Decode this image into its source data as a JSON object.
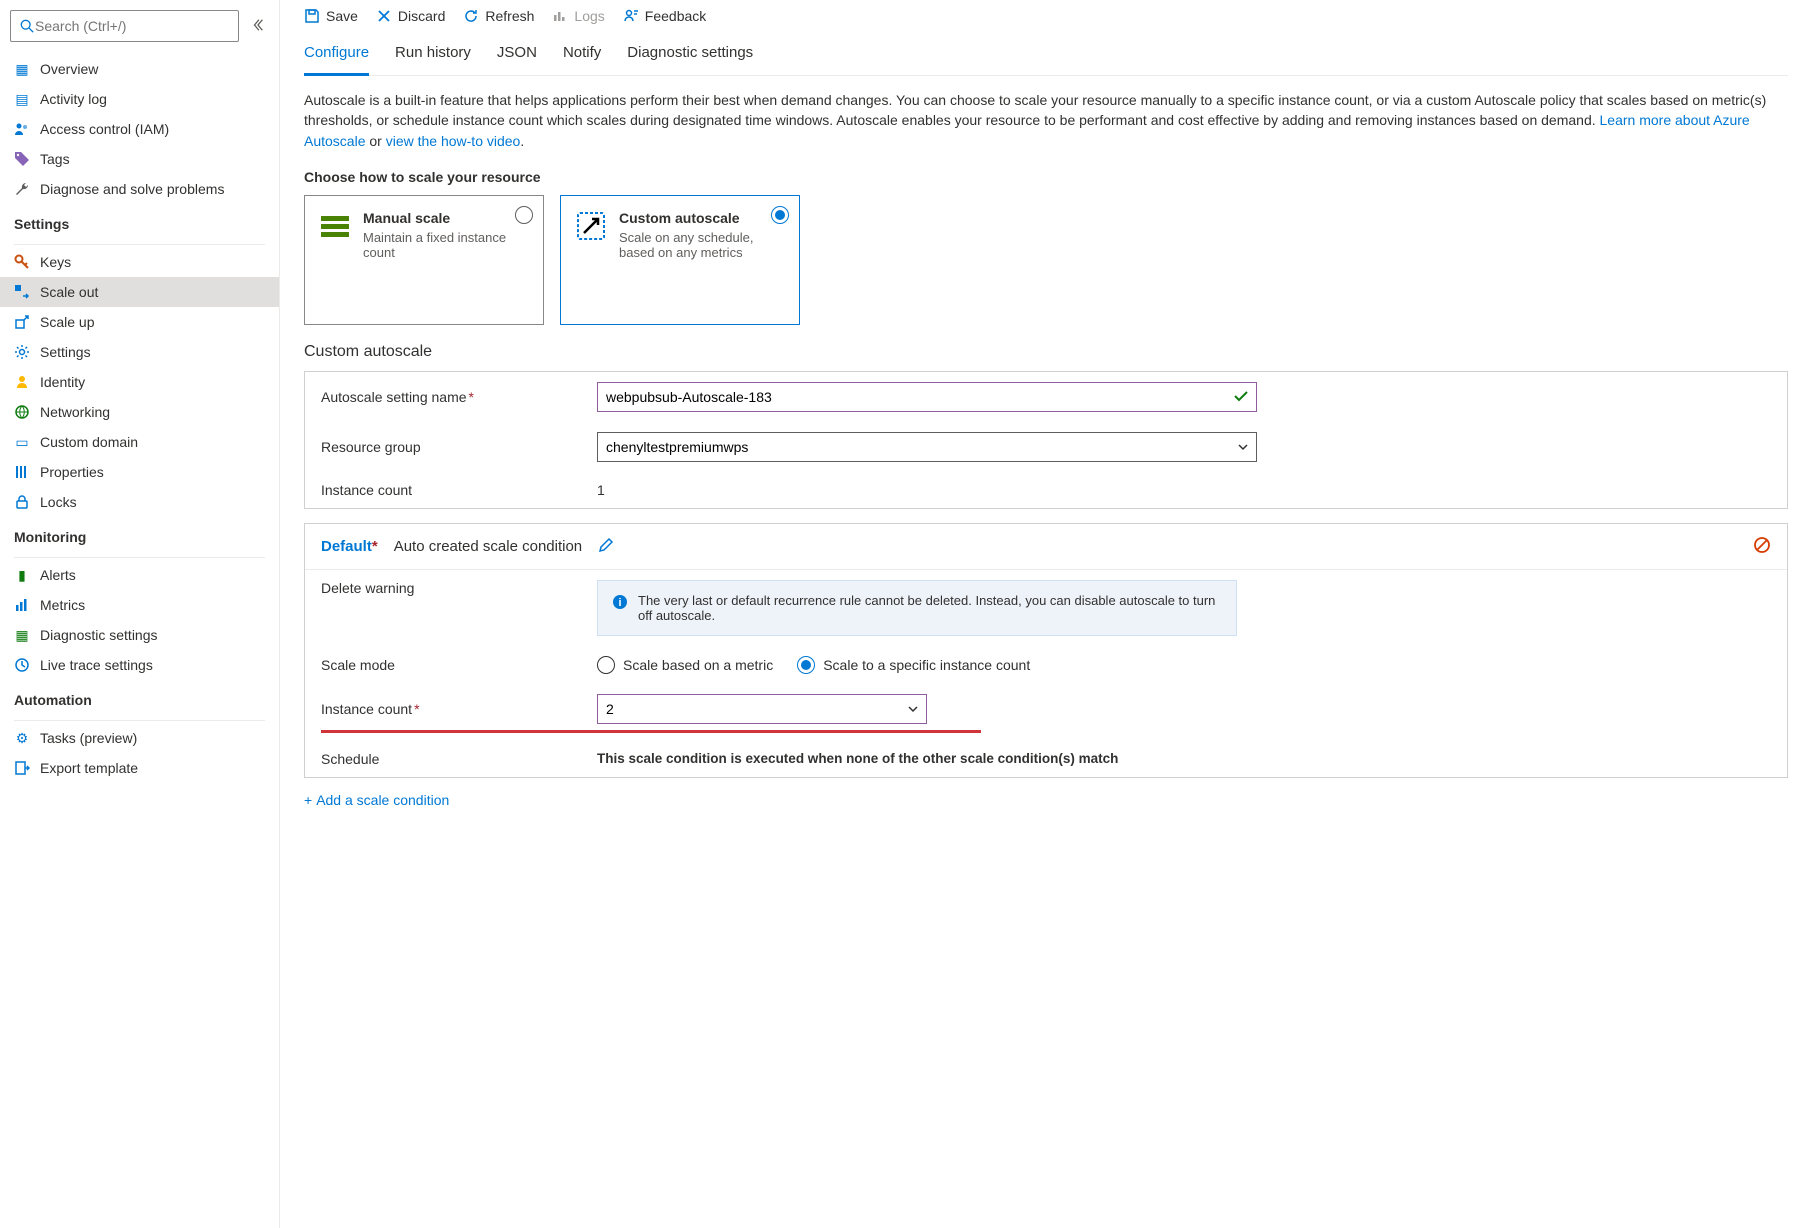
{
  "search": {
    "placeholder": "Search (Ctrl+/)"
  },
  "sidebar": {
    "items": [
      {
        "label": "Overview"
      },
      {
        "label": "Activity log"
      },
      {
        "label": "Access control (IAM)"
      },
      {
        "label": "Tags"
      },
      {
        "label": "Diagnose and solve problems"
      }
    ],
    "settings_title": "Settings",
    "settings": [
      {
        "label": "Keys"
      },
      {
        "label": "Scale out"
      },
      {
        "label": "Scale up"
      },
      {
        "label": "Settings"
      },
      {
        "label": "Identity"
      },
      {
        "label": "Networking"
      },
      {
        "label": "Custom domain"
      },
      {
        "label": "Properties"
      },
      {
        "label": "Locks"
      }
    ],
    "monitoring_title": "Monitoring",
    "monitoring": [
      {
        "label": "Alerts"
      },
      {
        "label": "Metrics"
      },
      {
        "label": "Diagnostic settings"
      },
      {
        "label": "Live trace settings"
      }
    ],
    "automation_title": "Automation",
    "automation": [
      {
        "label": "Tasks (preview)"
      },
      {
        "label": "Export template"
      }
    ]
  },
  "toolbar": {
    "save": "Save",
    "discard": "Discard",
    "refresh": "Refresh",
    "logs": "Logs",
    "feedback": "Feedback"
  },
  "tabs": {
    "configure": "Configure",
    "run_history": "Run history",
    "json": "JSON",
    "notify": "Notify",
    "diagnostic": "Diagnostic settings"
  },
  "intro": {
    "text": "Autoscale is a built-in feature that helps applications perform their best when demand changes. You can choose to scale your resource manually to a specific instance count, or via a custom Autoscale policy that scales based on metric(s) thresholds, or schedule instance count which scales during designated time windows. Autoscale enables your resource to be performant and cost effective by adding and removing instances based on demand. ",
    "link1": "Learn more about Azure Autoscale",
    "or": " or ",
    "link2": "view the how-to video",
    "dot": "."
  },
  "choose_label": "Choose how to scale your resource",
  "cards": {
    "manual": {
      "title": "Manual scale",
      "desc": "Maintain a fixed instance count"
    },
    "custom": {
      "title": "Custom autoscale",
      "desc": "Scale on any schedule, based on any metrics"
    }
  },
  "custom_section_title": "Custom autoscale",
  "form": {
    "setting_name_label": "Autoscale setting name",
    "setting_name_value": "webpubsub-Autoscale-183",
    "resource_group_label": "Resource group",
    "resource_group_value": "chenyltestpremiumwps",
    "instance_count_label": "Instance count",
    "instance_count_value": "1"
  },
  "condition": {
    "title": "Default",
    "subtitle": "Auto created scale condition",
    "delete_warning_label": "Delete warning",
    "delete_warning_text": "The very last or default recurrence rule cannot be deleted. Instead, you can disable autoscale to turn off autoscale.",
    "scale_mode_label": "Scale mode",
    "mode_metric": "Scale based on a metric",
    "mode_specific": "Scale to a specific instance count",
    "instance_count_label": "Instance count",
    "instance_count_value": "2",
    "schedule_label": "Schedule",
    "schedule_note": "This scale condition is executed when none of the other scale condition(s) match"
  },
  "add_condition": "Add a scale condition"
}
